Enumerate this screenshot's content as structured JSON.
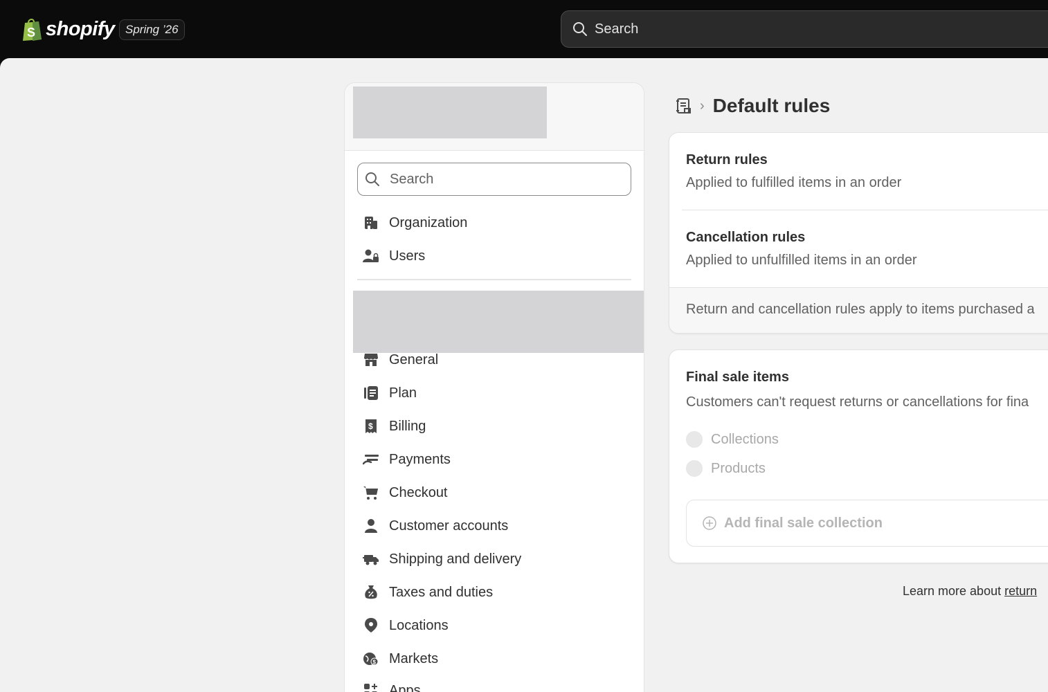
{
  "topbar": {
    "brand": "shopify",
    "release_badge": "Spring ’26",
    "search_placeholder": "Search"
  },
  "settings_nav": {
    "search_placeholder": "Search",
    "items_top": [
      {
        "label": "Organization",
        "icon": "building-icon"
      },
      {
        "label": "Users",
        "icon": "users-icon"
      }
    ],
    "items": [
      {
        "label": "General",
        "icon": "store-icon"
      },
      {
        "label": "Plan",
        "icon": "plan-icon"
      },
      {
        "label": "Billing",
        "icon": "billing-icon"
      },
      {
        "label": "Payments",
        "icon": "payments-icon"
      },
      {
        "label": "Checkout",
        "icon": "cart-icon"
      },
      {
        "label": "Customer accounts",
        "icon": "person-icon"
      },
      {
        "label": "Shipping and delivery",
        "icon": "truck-icon"
      },
      {
        "label": "Taxes and duties",
        "icon": "tax-icon"
      },
      {
        "label": "Locations",
        "icon": "location-pin-icon"
      },
      {
        "label": "Markets",
        "icon": "globe-icon"
      },
      {
        "label": "Apps",
        "icon": "apps-icon"
      }
    ]
  },
  "page": {
    "title": "Default rules",
    "breadcrumb_icon": "policy-icon"
  },
  "rules_card": {
    "return_title": "Return rules",
    "return_sub": "Applied to fulfilled items in an order",
    "cancel_title": "Cancellation rules",
    "cancel_sub": "Applied to unfulfilled items in an order",
    "footer": "Return and cancellation rules apply to items purchased a"
  },
  "final_sale_card": {
    "title": "Final sale items",
    "sub": "Customers can't request returns or cancellations for fina",
    "options": [
      "Collections",
      "Products"
    ],
    "add_button": "Add final sale collection"
  },
  "learn_more": {
    "text": "Learn more about ",
    "link": "return"
  },
  "colors": {
    "topbar_bg": "#0b0b0b",
    "canvas_bg": "#f1f1f1",
    "text_primary": "#303030",
    "text_secondary": "#616161",
    "placeholder_gray": "#d4d4d6"
  }
}
